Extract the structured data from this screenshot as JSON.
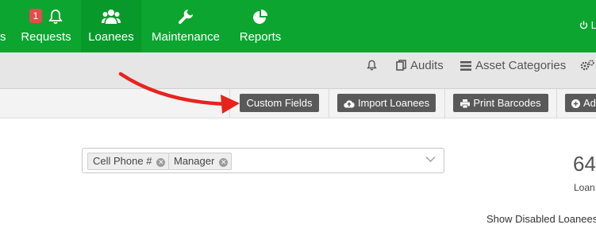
{
  "nav": {
    "items": [
      {
        "label": "s"
      },
      {
        "label": "Requests",
        "badge": "1"
      },
      {
        "label": "Loanees"
      },
      {
        "label": "Maintenance"
      },
      {
        "label": "Reports"
      }
    ],
    "user_label": "L",
    "colors": {
      "bar": "#0ba530",
      "active": "#079a2b",
      "badge": "#e54b4b"
    }
  },
  "subbar": {
    "audits": "Audits",
    "asset_categories": "Asset Categories"
  },
  "buttons": {
    "custom_fields": "Custom Fields",
    "import_loanees": "Import Loanees",
    "print_barcodes": "Print Barcodes",
    "add": "Ad"
  },
  "main": {
    "select_tags": [
      "Cell Phone #",
      "Manager"
    ],
    "count": "64",
    "count_label": "Loan",
    "show_disabled": "Show Disabled Loanees"
  },
  "annotation": {
    "arrow_color": "#e8231e"
  }
}
